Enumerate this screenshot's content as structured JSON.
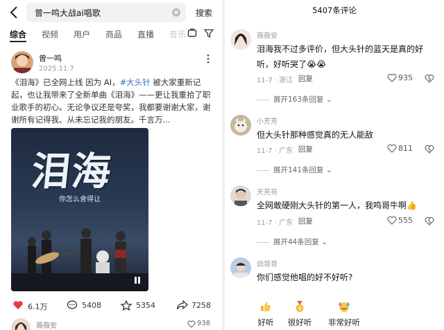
{
  "search": {
    "query": "曾一鸣大战ai唱歌",
    "button": "搜索"
  },
  "tabs": [
    {
      "label": "综合"
    },
    {
      "label": "视频"
    },
    {
      "label": "用户"
    },
    {
      "label": "商品"
    },
    {
      "label": "直播"
    },
    {
      "label": "音乐"
    }
  ],
  "post": {
    "author": "曾一鸣",
    "date": "2025.11.7",
    "text_a": "《泪海》已全网上线 因为 AI，",
    "hashtag": "#大头针",
    "text_b": " 被大家重新记起，也让我带来了全新单曲《泪海》——更让我重拾了职业歌手的初心。无论争议还是夸奖，我都要谢谢大家，谢谢所有记得我、从未忘记我的朋友。千言万...",
    "poster_title": "泪海",
    "poster_subtitle": "你怎么舍得让",
    "likes": "6.1万",
    "comments": "5408",
    "favorites": "5354",
    "shares": "7258",
    "peek_name": "薇薇安",
    "peek_likes": "938"
  },
  "comments_panel": {
    "count_label": "5407条评论",
    "reply_label": "回复",
    "comments": [
      {
        "name": "薇薇安",
        "text": "泪海我不过多评价，但大头针的蓝天是真的好听，好听哭了😭😭",
        "meta": "11-7 · 浙江",
        "likes": "935",
        "expand": "展开163条回复"
      },
      {
        "name": "小芳芳",
        "text": "但大头针那种感觉真的无人能敌",
        "meta": "11-7 · 广东",
        "likes": "811",
        "expand": "展开141条回复"
      },
      {
        "name": "天亮亮",
        "text": "全网敢硬刚大头针的第一人，我鸣哥牛啊👍",
        "meta": "11-7 · 广东",
        "likes": "555",
        "expand": "展开44条回复"
      },
      {
        "name": "劲哥哥",
        "text": "你们感觉他唱的好不好听?"
      }
    ],
    "poll": [
      {
        "label": "好听",
        "emoji": "thumbs-up-icon"
      },
      {
        "label": "很好听",
        "emoji": "medal-icon"
      },
      {
        "label": "非常好听",
        "emoji": "party-icon"
      }
    ]
  },
  "colors": {
    "hashtag": "#3b6fb6",
    "like_heart": "#e8384d",
    "divider": "#f0f0f0"
  }
}
